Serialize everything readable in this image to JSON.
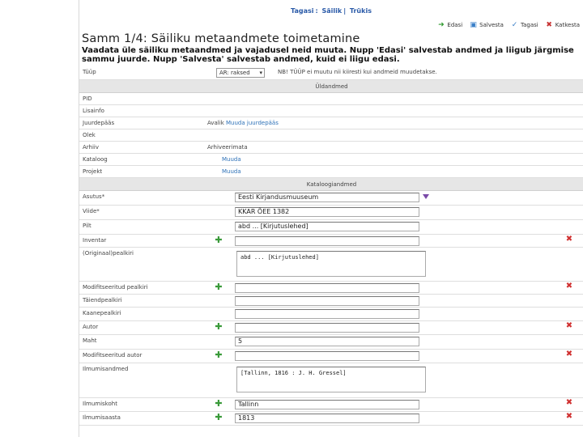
{
  "breadcrumb": {
    "item1": "Tagasi",
    "item2": "Säilik",
    "item3": "Trükis"
  },
  "toolbar": {
    "next": "Edasi",
    "save": "Salvesta",
    "back": "Tagasi",
    "cancel": "Katkesta"
  },
  "page_title": "Samm 1/4: Säiliku metaandmete toimetamine",
  "intro": "Vaadata üle säiliku metaandmed ja vajadusel neid muuta. Nupp 'Edasi' salvestab andmed ja liigub järgmise sammu juurde. Nupp 'Salvesta' salvestab andmed, kuid ei liigu edasi.",
  "doctype": {
    "label": "Tüüp",
    "selected": "AR: raksed",
    "note": "NB! TÜÜP ei muutu nii kiiresti kui andmeid muudetakse."
  },
  "sections": {
    "general": "Üldandmed",
    "catalog": "Kataloogiandmed"
  },
  "general_rows": [
    {
      "label": "PID",
      "value": "",
      "link": ""
    },
    {
      "label": "Lisainfo",
      "value": "",
      "link": ""
    },
    {
      "label": "Juurdepääs",
      "value": "Avalik",
      "link": "Muuda juurdepääs"
    },
    {
      "label": "Olek",
      "value": "",
      "link": ""
    },
    {
      "label": "Arhiiv",
      "value": "Arhiveerimata",
      "link": ""
    },
    {
      "label": "Kataloog",
      "value": "",
      "link": "Muuda"
    },
    {
      "label": "Projekt",
      "value": "",
      "link": "Muuda"
    }
  ],
  "catalog": {
    "asutus": {
      "label": "Asutus*",
      "value": "Eesti Kirjandusmuuseum"
    },
    "viide": {
      "label": "Viide*",
      "value": "KKAR ÕEE 1382"
    },
    "pilt": {
      "label": "Pilt",
      "value": "abd ... [Kirjutuslehed]"
    },
    "inventar": {
      "label": "Inventar"
    },
    "pealkiri": {
      "label": "(Originaal)pealkiri",
      "value": "abd ... [Kirjutuslehed]"
    },
    "mod_pealkiri": {
      "label": "Modifitseeritud pealkiri"
    },
    "taiendpealkiri": {
      "label": "Täiendpealkiri"
    },
    "kaanepealkiri": {
      "label": "Kaanepealkiri"
    },
    "autor": {
      "label": "Autor"
    },
    "maht": {
      "label": "Maht",
      "value": "5"
    },
    "mod_autor": {
      "label": "Modifitseeritud autor"
    },
    "ilmumisandmed": {
      "label": "Ilmumisandmed",
      "value": "[Tallinn, 1816 : J. H. Gressel]"
    },
    "ilmumiskoht": {
      "label": "Ilmumiskoht",
      "value": "Tallinn"
    },
    "ilmumisaasta": {
      "label": "Ilmumisaasta",
      "value": "1813"
    }
  }
}
